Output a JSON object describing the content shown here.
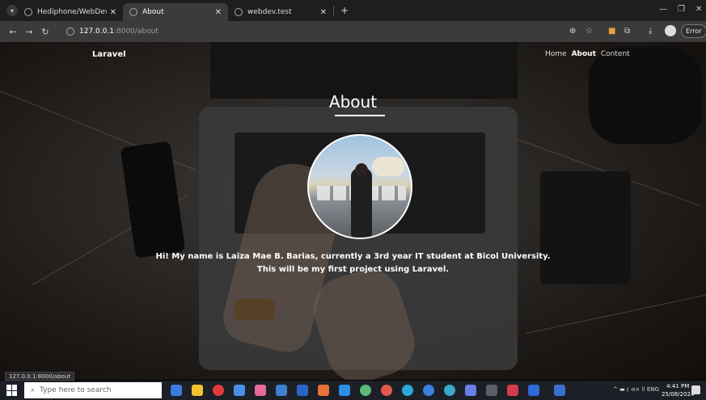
{
  "browser": {
    "tabs": [
      {
        "label": "Hediphone/WebDev",
        "active": false
      },
      {
        "label": "About",
        "active": true
      },
      {
        "label": "webdev.test",
        "active": false
      }
    ],
    "new_tab_label": "+",
    "url_host": "127.0.0.1",
    "url_path": ":8000/about",
    "error_label": "Error"
  },
  "site": {
    "brand": "Laravel",
    "nav": [
      {
        "label": "Home",
        "current": false
      },
      {
        "label": "About",
        "current": true
      },
      {
        "label": "Content",
        "current": false
      }
    ],
    "heading": "About",
    "bio_line1": "Hi! My name is Laiza Mae B. Barias, currently a 3rd year IT student at Bicol University.",
    "bio_line2": "This will be my first project using Laravel."
  },
  "status_bar_url": "127.0.0.1:8000/about",
  "taskbar": {
    "search_placeholder": "Type here to search",
    "tray_text": "^ ▬ ⦅ ⊲× ⌷ ENG",
    "time": "4:41 PM",
    "date": "25/08/2024"
  },
  "colors": {
    "tabbar_bg": "#1e1e20",
    "toolbar_bg": "#3b3b3e",
    "taskbar_bg": "#1c1f26"
  }
}
